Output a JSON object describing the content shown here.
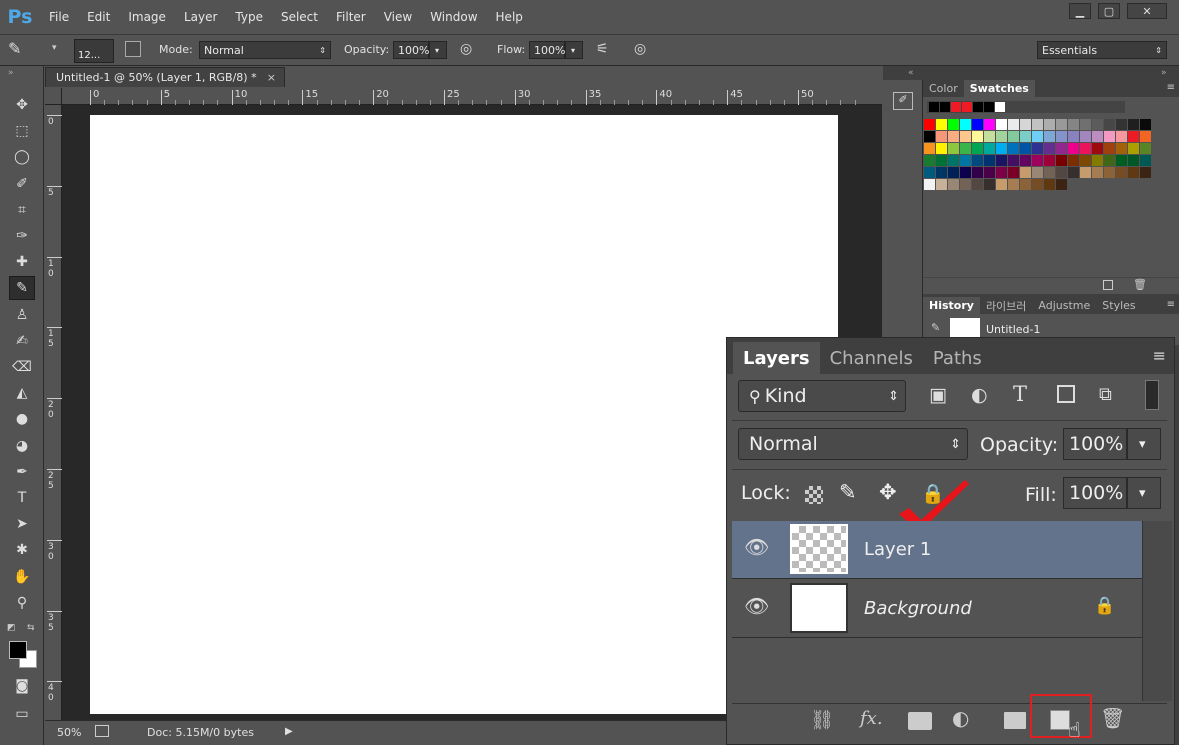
{
  "app": {
    "logo": "Ps"
  },
  "menu": [
    "File",
    "Edit",
    "Image",
    "Layer",
    "Type",
    "Select",
    "Filter",
    "View",
    "Window",
    "Help"
  ],
  "window_controls": {
    "minimize": "▁",
    "maximize": "▢",
    "close": "✕"
  },
  "options": {
    "brush_size": "12...",
    "mode_label": "Mode:",
    "mode_value": "Normal",
    "opacity_label": "Opacity:",
    "opacity_value": "100%",
    "flow_label": "Flow:",
    "flow_value": "100%",
    "workspace": "Essentials"
  },
  "document": {
    "tab_title": "Untitled-1 @ 50% (Layer 1, RGB/8) *",
    "close": "×",
    "ruler_h": [
      "0",
      "5",
      "10",
      "15",
      "20",
      "25",
      "30",
      "35",
      "40",
      "45",
      "50"
    ],
    "ruler_v": [
      "0",
      "5",
      "1\n0",
      "1\n5",
      "2\n0",
      "2\n5",
      "3\n0",
      "3\n5",
      "4\n0"
    ],
    "zoom": "50%",
    "doc_info": "Doc: 5.15M/0 bytes"
  },
  "swatch_panel": {
    "tabs": [
      "Color",
      "Swatches"
    ],
    "recent": [
      "#000000",
      "#000000",
      "#ed1c24",
      "#ed1c24",
      "#000000",
      "#000000",
      "#ffffff"
    ],
    "rows": [
      [
        "#ff0000",
        "#ffff00",
        "#00ff00",
        "#00ffff",
        "#0000ff",
        "#ff00ff",
        "#ffffff",
        "#ebebeb",
        "#d6d6d6",
        "#c2c2c2",
        "#adadad",
        "#999999",
        "#858585",
        "#707070",
        "#5c5c5c",
        "#474747",
        "#333333",
        "#1f1f1f",
        "#0a0a0a"
      ],
      [
        "#000000",
        "#f7977a",
        "#f9ad81",
        "#fdc68a",
        "#fff79a",
        "#c4df9b",
        "#a3d39c",
        "#82ca9d",
        "#7bcdc8",
        "#6ecff6",
        "#7ea7d8",
        "#8493ca",
        "#8882be",
        "#a187be",
        "#bc8dbf",
        "#f49ac2",
        "#f6989d",
        "#ed1c24",
        "#f26522"
      ],
      [
        "#f7941d",
        "#fff200",
        "#8dc63f",
        "#39b54a",
        "#00a651",
        "#00a99d",
        "#00aeef",
        "#0072bc",
        "#0054a6",
        "#2e3192",
        "#662d91",
        "#92278f",
        "#ec008c",
        "#ed145b",
        "#9e0b0f",
        "#a0410d",
        "#a36209",
        "#aba000",
        "#598527"
      ],
      [
        "#197b30",
        "#007236",
        "#00746b",
        "#0076a3",
        "#004a80",
        "#003471",
        "#1b1464",
        "#440e62",
        "#630460",
        "#9e005d",
        "#9e0039",
        "#790000",
        "#7b2e00",
        "#7d4900",
        "#827b00",
        "#406618",
        "#005e20",
        "#005826",
        "#005952"
      ],
      [
        "#005b7f",
        "#003663",
        "#002157",
        "#0d004c",
        "#32004b",
        "#4b0049",
        "#7b0046",
        "#7a0026",
        "#c69c6d",
        "#998675",
        "#736357",
        "#534741",
        "#362f2d",
        "#c69c6d",
        "#a67c52",
        "#8c6239",
        "#754c24",
        "#603913",
        "#3c2415"
      ],
      [
        "#f2f2f2",
        "#c7b299",
        "#998675",
        "#736357",
        "#534741",
        "#362f2d",
        "#c69c6d",
        "#a67c52",
        "#8c6239",
        "#754c24",
        "#603913",
        "#3c2415"
      ]
    ]
  },
  "history_panel": {
    "tabs": [
      "History",
      "라이브러",
      "Adjustme",
      "Styles"
    ],
    "item": "Untitled-1"
  },
  "layers_panel": {
    "tabs": [
      "Layers",
      "Channels",
      "Paths"
    ],
    "kind_label": "Kind",
    "blend_mode": "Normal",
    "opacity_label": "Opacity:",
    "opacity_value": "100%",
    "lock_label": "Lock:",
    "fill_label": "Fill:",
    "fill_value": "100%",
    "layers": [
      {
        "name": "Layer 1",
        "selected": true
      },
      {
        "name": "Background",
        "locked": true
      }
    ],
    "footer_icons": [
      "link-icon",
      "fx-icon",
      "mask-icon",
      "adjustment-icon",
      "folder-icon",
      "new-layer-icon",
      "trash-icon"
    ]
  },
  "colors": {
    "highlight": "#64738c",
    "callout": "#e02020",
    "checkmark": "#e8141a"
  }
}
